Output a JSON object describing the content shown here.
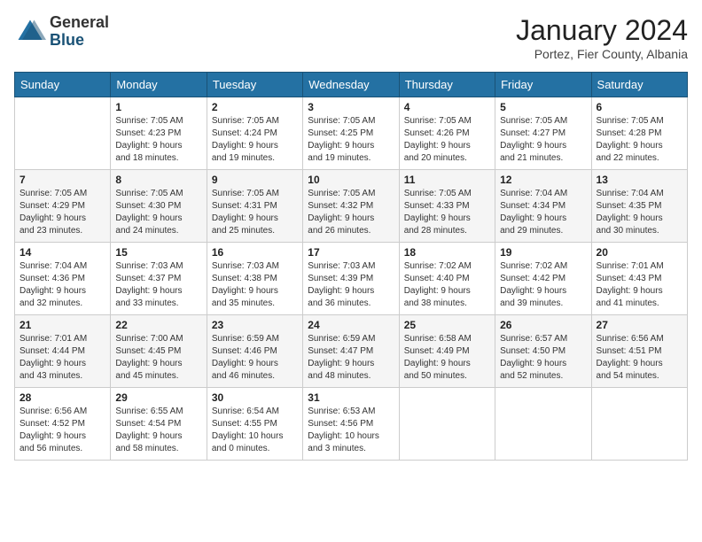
{
  "header": {
    "logo_general": "General",
    "logo_blue": "Blue",
    "month_year": "January 2024",
    "location": "Portez, Fier County, Albania"
  },
  "weekdays": [
    "Sunday",
    "Monday",
    "Tuesday",
    "Wednesday",
    "Thursday",
    "Friday",
    "Saturday"
  ],
  "weeks": [
    [
      {
        "day": "",
        "content": ""
      },
      {
        "day": "1",
        "content": "Sunrise: 7:05 AM\nSunset: 4:23 PM\nDaylight: 9 hours\nand 18 minutes."
      },
      {
        "day": "2",
        "content": "Sunrise: 7:05 AM\nSunset: 4:24 PM\nDaylight: 9 hours\nand 19 minutes."
      },
      {
        "day": "3",
        "content": "Sunrise: 7:05 AM\nSunset: 4:25 PM\nDaylight: 9 hours\nand 19 minutes."
      },
      {
        "day": "4",
        "content": "Sunrise: 7:05 AM\nSunset: 4:26 PM\nDaylight: 9 hours\nand 20 minutes."
      },
      {
        "day": "5",
        "content": "Sunrise: 7:05 AM\nSunset: 4:27 PM\nDaylight: 9 hours\nand 21 minutes."
      },
      {
        "day": "6",
        "content": "Sunrise: 7:05 AM\nSunset: 4:28 PM\nDaylight: 9 hours\nand 22 minutes."
      }
    ],
    [
      {
        "day": "7",
        "content": "Sunrise: 7:05 AM\nSunset: 4:29 PM\nDaylight: 9 hours\nand 23 minutes."
      },
      {
        "day": "8",
        "content": "Sunrise: 7:05 AM\nSunset: 4:30 PM\nDaylight: 9 hours\nand 24 minutes."
      },
      {
        "day": "9",
        "content": "Sunrise: 7:05 AM\nSunset: 4:31 PM\nDaylight: 9 hours\nand 25 minutes."
      },
      {
        "day": "10",
        "content": "Sunrise: 7:05 AM\nSunset: 4:32 PM\nDaylight: 9 hours\nand 26 minutes."
      },
      {
        "day": "11",
        "content": "Sunrise: 7:05 AM\nSunset: 4:33 PM\nDaylight: 9 hours\nand 28 minutes."
      },
      {
        "day": "12",
        "content": "Sunrise: 7:04 AM\nSunset: 4:34 PM\nDaylight: 9 hours\nand 29 minutes."
      },
      {
        "day": "13",
        "content": "Sunrise: 7:04 AM\nSunset: 4:35 PM\nDaylight: 9 hours\nand 30 minutes."
      }
    ],
    [
      {
        "day": "14",
        "content": "Sunrise: 7:04 AM\nSunset: 4:36 PM\nDaylight: 9 hours\nand 32 minutes."
      },
      {
        "day": "15",
        "content": "Sunrise: 7:03 AM\nSunset: 4:37 PM\nDaylight: 9 hours\nand 33 minutes."
      },
      {
        "day": "16",
        "content": "Sunrise: 7:03 AM\nSunset: 4:38 PM\nDaylight: 9 hours\nand 35 minutes."
      },
      {
        "day": "17",
        "content": "Sunrise: 7:03 AM\nSunset: 4:39 PM\nDaylight: 9 hours\nand 36 minutes."
      },
      {
        "day": "18",
        "content": "Sunrise: 7:02 AM\nSunset: 4:40 PM\nDaylight: 9 hours\nand 38 minutes."
      },
      {
        "day": "19",
        "content": "Sunrise: 7:02 AM\nSunset: 4:42 PM\nDaylight: 9 hours\nand 39 minutes."
      },
      {
        "day": "20",
        "content": "Sunrise: 7:01 AM\nSunset: 4:43 PM\nDaylight: 9 hours\nand 41 minutes."
      }
    ],
    [
      {
        "day": "21",
        "content": "Sunrise: 7:01 AM\nSunset: 4:44 PM\nDaylight: 9 hours\nand 43 minutes."
      },
      {
        "day": "22",
        "content": "Sunrise: 7:00 AM\nSunset: 4:45 PM\nDaylight: 9 hours\nand 45 minutes."
      },
      {
        "day": "23",
        "content": "Sunrise: 6:59 AM\nSunset: 4:46 PM\nDaylight: 9 hours\nand 46 minutes."
      },
      {
        "day": "24",
        "content": "Sunrise: 6:59 AM\nSunset: 4:47 PM\nDaylight: 9 hours\nand 48 minutes."
      },
      {
        "day": "25",
        "content": "Sunrise: 6:58 AM\nSunset: 4:49 PM\nDaylight: 9 hours\nand 50 minutes."
      },
      {
        "day": "26",
        "content": "Sunrise: 6:57 AM\nSunset: 4:50 PM\nDaylight: 9 hours\nand 52 minutes."
      },
      {
        "day": "27",
        "content": "Sunrise: 6:56 AM\nSunset: 4:51 PM\nDaylight: 9 hours\nand 54 minutes."
      }
    ],
    [
      {
        "day": "28",
        "content": "Sunrise: 6:56 AM\nSunset: 4:52 PM\nDaylight: 9 hours\nand 56 minutes."
      },
      {
        "day": "29",
        "content": "Sunrise: 6:55 AM\nSunset: 4:54 PM\nDaylight: 9 hours\nand 58 minutes."
      },
      {
        "day": "30",
        "content": "Sunrise: 6:54 AM\nSunset: 4:55 PM\nDaylight: 10 hours\nand 0 minutes."
      },
      {
        "day": "31",
        "content": "Sunrise: 6:53 AM\nSunset: 4:56 PM\nDaylight: 10 hours\nand 3 minutes."
      },
      {
        "day": "",
        "content": ""
      },
      {
        "day": "",
        "content": ""
      },
      {
        "day": "",
        "content": ""
      }
    ]
  ]
}
